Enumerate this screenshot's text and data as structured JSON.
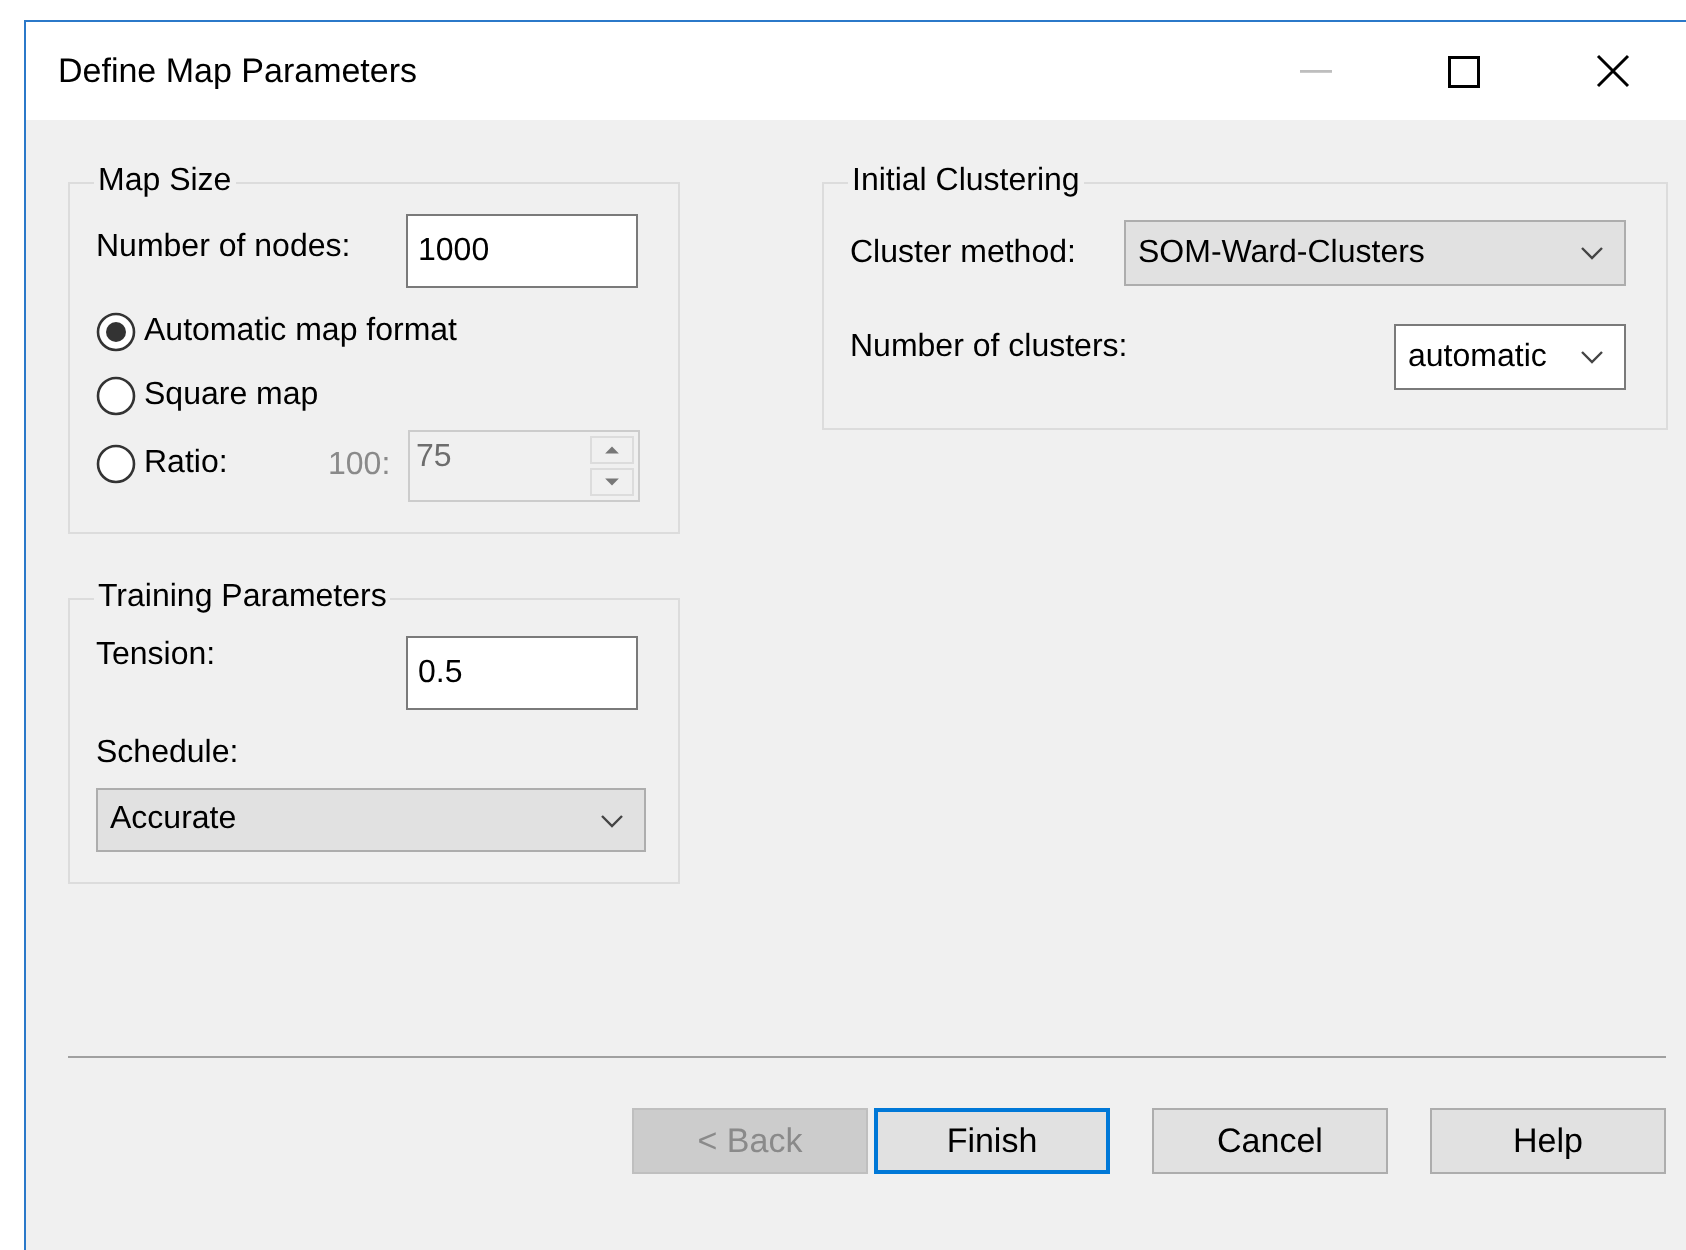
{
  "window": {
    "title": "Define Map Parameters",
    "minimize_disabled": true
  },
  "map_size": {
    "title": "Map Size",
    "nodes_label": "Number of nodes:",
    "nodes_value": "1000",
    "format_options": [
      {
        "label": "Automatic map format",
        "selected": true
      },
      {
        "label": "Square map",
        "selected": false
      },
      {
        "label": "Ratio:",
        "selected": false
      }
    ],
    "ratio": {
      "prefix": "100:",
      "value": "75",
      "disabled": true
    }
  },
  "training": {
    "title": "Training Parameters",
    "tension_label": "Tension:",
    "tension_value": "0.5",
    "schedule_label": "Schedule:",
    "schedule": {
      "value": "Accurate",
      "kind": "list"
    }
  },
  "clustering": {
    "title": "Initial Clustering",
    "method_label": "Cluster method:",
    "method": {
      "value": "SOM-Ward-Clusters",
      "kind": "list"
    },
    "count_label": "Number of clusters:",
    "count": {
      "value": "automatic",
      "kind": "editable"
    }
  },
  "buttons": [
    {
      "label": "< Back",
      "disabled": true,
      "default": false
    },
    {
      "label": "Finish",
      "disabled": false,
      "default": true
    },
    {
      "label": "Cancel",
      "disabled": false,
      "default": false
    },
    {
      "label": "Help",
      "disabled": false,
      "default": false
    }
  ]
}
